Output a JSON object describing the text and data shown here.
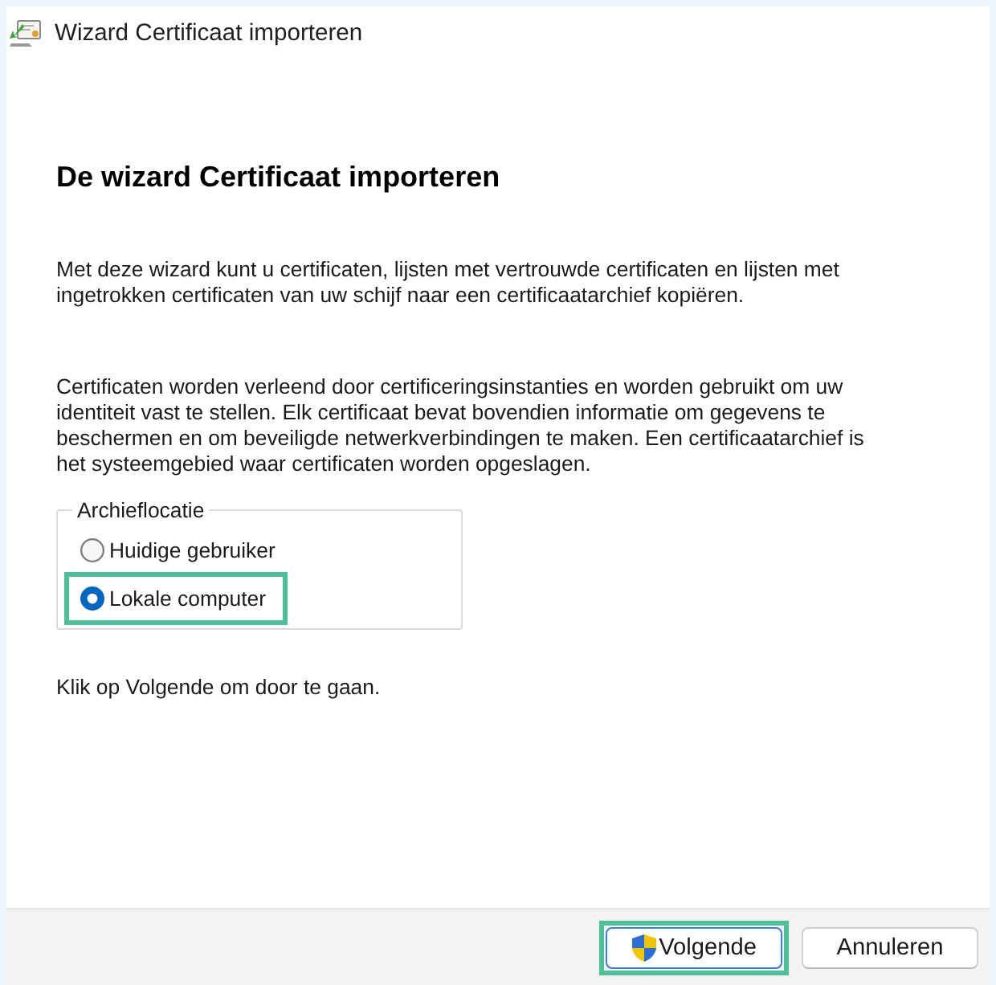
{
  "window": {
    "title": "Wizard Certificaat importeren"
  },
  "page": {
    "heading": "De wizard Certificaat importeren",
    "paragraphs": [
      "Met deze wizard kunt u certificaten, lijsten met vertrouwde certificaten en lijsten met ingetrokken certificaten van uw schijf naar een certificaatarchief kopiëren.",
      "Certificaten worden verleend door certificeringsinstanties en worden gebruikt om uw identiteit vast te stellen. Elk certificaat bevat bovendien informatie om gegevens te beschermen en om beveiligde netwerkverbindingen te maken. Een certificaatarchief is het systeemgebied waar certificaten worden opgeslagen."
    ]
  },
  "location": {
    "legend": "Archieflocatie",
    "options": [
      {
        "label": "Huidige gebruiker",
        "selected": false,
        "highlighted": false
      },
      {
        "label": "Lokale computer",
        "selected": true,
        "highlighted": true
      }
    ]
  },
  "instruction": "Klik op Volgende om door te gaan.",
  "buttons": [
    {
      "label": "Volgende",
      "kind": "shield",
      "default": true,
      "highlighted": true
    },
    {
      "label": "Annuleren",
      "kind": "plain",
      "default": false,
      "highlighted": false
    }
  ]
}
